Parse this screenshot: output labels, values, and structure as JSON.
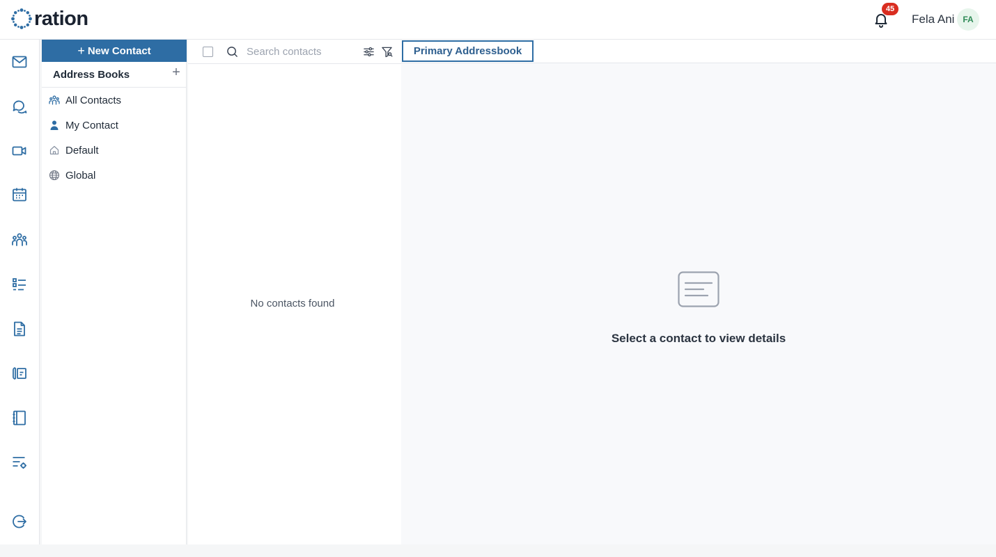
{
  "header": {
    "logo_text": "ration",
    "notifications_count": "45",
    "user_name": "Fela Ani",
    "user_initials": "FA"
  },
  "rail": {
    "icons": [
      "mail-icon",
      "chat-icon",
      "video-icon",
      "calendar-icon",
      "contacts-icon",
      "tasks-icon",
      "document-icon",
      "forms-icon",
      "notebook-icon",
      "settings-list-icon",
      "logout-icon"
    ]
  },
  "address_books": {
    "new_contact_label": "New Contact",
    "title": "Address Books",
    "items": [
      {
        "label": "All Contacts",
        "icon": "group-icon"
      },
      {
        "label": "My Contact",
        "icon": "person-icon"
      },
      {
        "label": "Default",
        "icon": "home-icon"
      },
      {
        "label": "Global",
        "icon": "globe-icon"
      }
    ]
  },
  "contact_list": {
    "search_placeholder": "Search contacts",
    "empty_message": "No contacts found"
  },
  "detail": {
    "tab_label": "Primary Addressbook",
    "empty_message": "Select a contact to view details"
  },
  "colors": {
    "accent": "#2e6da4",
    "badge": "#d92d20",
    "avatar_bg": "#e7f5ec",
    "avatar_text": "#2f8a57"
  }
}
